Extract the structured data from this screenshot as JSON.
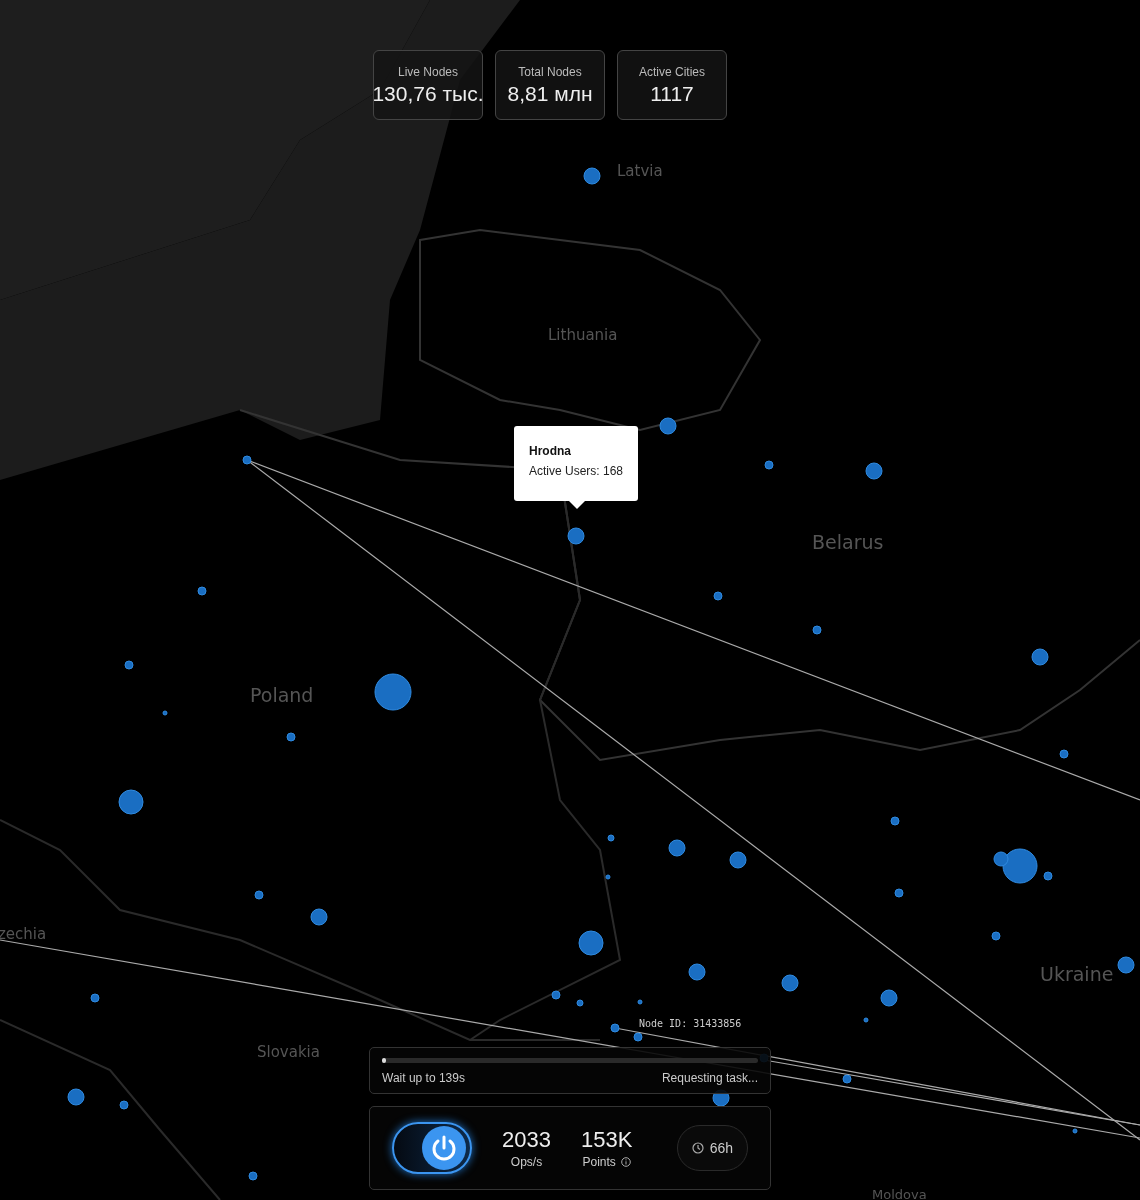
{
  "stats": [
    {
      "label": "Live Nodes",
      "value": "130,76 тыс."
    },
    {
      "label": "Total Nodes",
      "value": "8,81 млн"
    },
    {
      "label": "Active Cities",
      "value": "1117"
    }
  ],
  "map_labels": [
    "Latvia",
    "Lithuania",
    "Belarus",
    "Poland",
    "Ukraine",
    "zechia",
    "Slovakia",
    "Moldova"
  ],
  "tooltip": {
    "title": "Hrodna",
    "text": "Active Users: 168"
  },
  "node_id": "Node ID: 31433856",
  "task": {
    "level": 0.01,
    "wait": "Wait up to 139s",
    "status": "Requesting task..."
  },
  "controls": {
    "power_on": true,
    "metrics": [
      {
        "value": "2033",
        "label": "Ops/s",
        "info": false
      },
      {
        "value": "153K",
        "label": "Points",
        "info": true
      }
    ],
    "uptime": "66h"
  }
}
